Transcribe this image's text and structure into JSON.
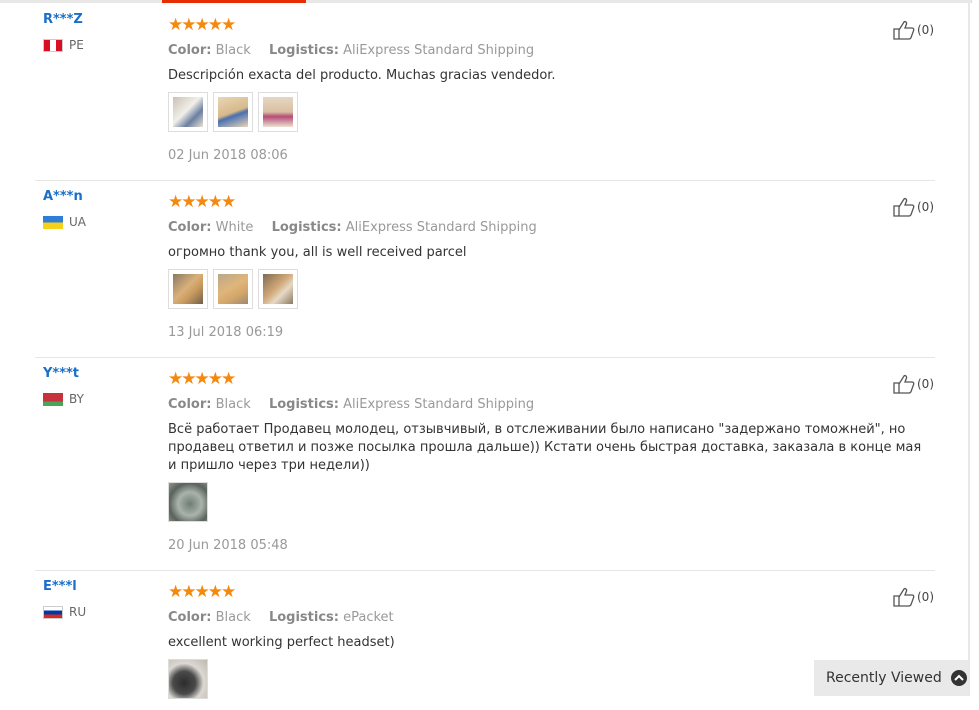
{
  "reviews": [
    {
      "user": "R***Z",
      "country": "PE",
      "stars": "★★★★★",
      "color_label": "Color:",
      "color_value": "Black",
      "logistics_label": "Logistics:",
      "logistics_value": "AliExpress Standard Shipping",
      "text": "Descripción exacta del producto. Muchas gracias vendedor.",
      "date": "02 Jun 2018 08:06",
      "helpful": "(0)"
    },
    {
      "user": "A***n",
      "country": "UA",
      "stars": "★★★★★",
      "color_label": "Color:",
      "color_value": "White",
      "logistics_label": "Logistics:",
      "logistics_value": "AliExpress Standard Shipping",
      "text": "огромно thank you, all is well received parcel",
      "date": "13 Jul 2018 06:19",
      "helpful": "(0)"
    },
    {
      "user": "Y***t",
      "country": "BY",
      "stars": "★★★★★",
      "color_label": "Color:",
      "color_value": "Black",
      "logistics_label": "Logistics:",
      "logistics_value": "AliExpress Standard Shipping",
      "text": "Всё работает Продавец молодец, отзывчивый, в отслеживании было написано \"задержано томожней\", но продавец ответил и позже посылка прошла дальше)) Кстати очень быстрая доставка, заказала в конце мая и пришло через три недели))",
      "date": "20 Jun 2018 05:48",
      "helpful": "(0)"
    },
    {
      "user": "E***l",
      "country": "RU",
      "stars": "★★★★★",
      "color_label": "Color:",
      "color_value": "Black",
      "logistics_label": "Logistics:",
      "logistics_value": "ePacket",
      "text": "excellent working perfect headset)",
      "helpful": "(0)"
    }
  ],
  "recently_viewed": "Recently Viewed",
  "colors": {
    "accent": "#e62e04",
    "username": "#1a6fc9",
    "star": "#f5890f"
  },
  "icons": [
    "thumbs-up-icon",
    "chevron-up-icon"
  ]
}
